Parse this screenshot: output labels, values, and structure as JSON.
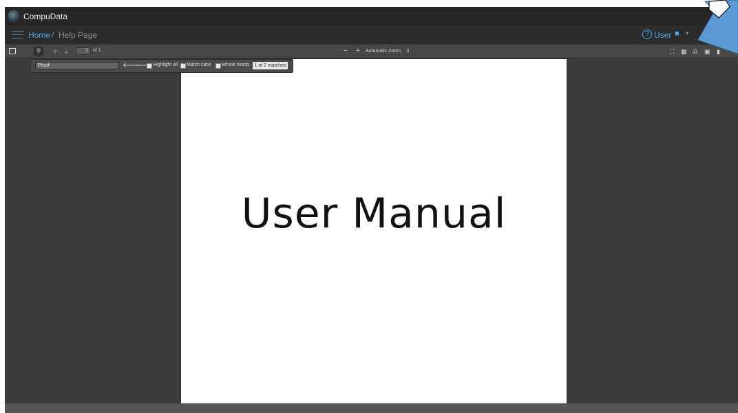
{
  "app": {
    "title": "CompuData"
  },
  "nav": {
    "breadcrumb_home": "Home",
    "breadcrumb_separator": "/",
    "breadcrumb_current": "Help Page",
    "help_icon_glyph": "?",
    "user_label": "User",
    "accent_color": "#4aa3e0"
  },
  "pdf_toolbar": {
    "page_number": "1",
    "page_count": "of 1",
    "zoom_out": "−",
    "zoom_in": "+",
    "zoom_label": "Automatic Zoom",
    "zoom_caret": "⇕"
  },
  "findbar": {
    "query": "Proof",
    "prev_glyph": "🡐",
    "next_glyph": "🡒",
    "highlight_all": "Highlight all",
    "match_case": "Match case",
    "whole_words": "Whole words",
    "match_count": "1 of 2 matches"
  },
  "document": {
    "title": "User Manual"
  },
  "icons": [
    "logo-icon",
    "menu-icon",
    "help-icon",
    "user-icon",
    "sidebar-toggle-icon",
    "search-icon",
    "prev-page-icon",
    "next-page-icon",
    "presentation-icon",
    "open-file-icon",
    "print-icon",
    "download-icon",
    "bookmark-icon",
    "callout-arrow-icon"
  ]
}
